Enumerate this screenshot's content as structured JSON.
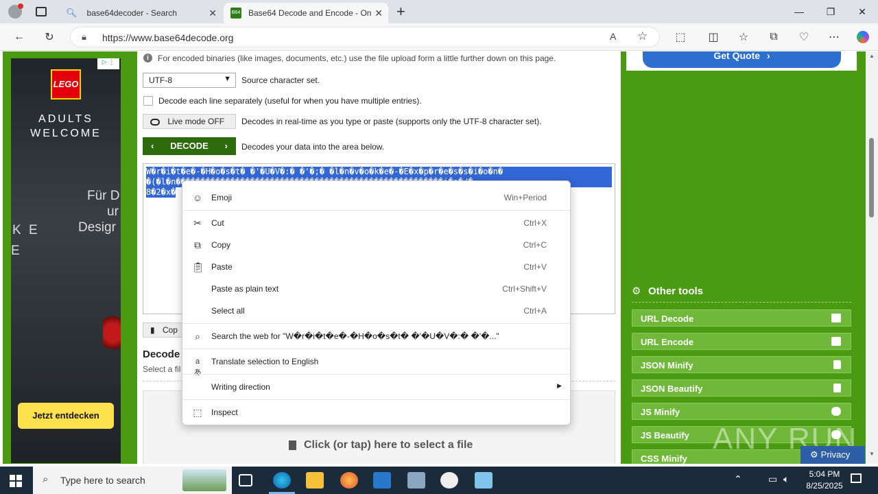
{
  "browser": {
    "tabs": [
      {
        "title": "base64decoder - Search"
      },
      {
        "title": "Base64 Decode and Encode - Onl"
      }
    ],
    "url": "https://www.base64decode.org",
    "new_tab_label": "+"
  },
  "ad_left": {
    "brand": "LEGO",
    "tagline_1": "ADULTS",
    "tagline_2": "WELCOME",
    "fragment_1": "Für D",
    "fragment_2": "ur",
    "fragment_3": "Desigr",
    "fragment_4": "K E",
    "fragment_5": "E",
    "cta": "Jetzt entdecken"
  },
  "content": {
    "info_text": "For encoded binaries (like images, documents, etc.) use the file upload form a little further down on this page.",
    "charset_value": "UTF-8",
    "charset_label": "Source character set.",
    "decode_lines_label": "Decode each line separately (useful for when you have multiple entries).",
    "live_mode_label": "Live mode OFF",
    "live_mode_desc": "Decodes in real-time as you type or paste (supports only the UTF-8 character set).",
    "decode_button": "DECODE",
    "decode_desc": "Decodes your data into the area below.",
    "output_line_1": "W�r�i�t�e�-�H�o�s�t� �'�U�V�:� �'�;� �l�n�v�o�k�e�-�E�x�p�r�e�s�s�i�o�n�",
    "output_line_2": "�(�l�n������������������������������������������������������i�o�/�",
    "output_line_3": "8�2�x�",
    "copy_label": "Cop",
    "decode_files_heading": "Decode",
    "select_file_label": "Select a fil",
    "upload_label": "Click (or tap) here to select a file"
  },
  "right": {
    "get_quote": "Get Quote",
    "other_tools_heading": "Other tools",
    "tools": [
      "URL Decode",
      "URL Encode",
      "JSON Minify",
      "JSON Beautify",
      "JS Minify",
      "JS Beautify",
      "CSS Minify"
    ],
    "watermark": "ANY RUN",
    "privacy": "Privacy"
  },
  "context_menu": {
    "items": [
      {
        "label": "Emoji",
        "shortcut": "Win+Period"
      },
      {
        "label": "Cut",
        "shortcut": "Ctrl+X"
      },
      {
        "label": "Copy",
        "shortcut": "Ctrl+C"
      },
      {
        "label": "Paste",
        "shortcut": "Ctrl+V"
      },
      {
        "label": "Paste as plain text",
        "shortcut": "Ctrl+Shift+V"
      },
      {
        "label": "Select all",
        "shortcut": "Ctrl+A"
      },
      {
        "label": "Search the web for \"W�r�i�t�e�-�H�o�s�t� �'�U�V�:� �'�...\"",
        "shortcut": ""
      },
      {
        "label": "Translate selection to English",
        "shortcut": ""
      },
      {
        "label": "Writing direction",
        "shortcut": ""
      },
      {
        "label": "Inspect",
        "shortcut": ""
      }
    ]
  },
  "taskbar": {
    "search_placeholder": "Type here to search",
    "time": "5:04 PM",
    "date": "8/25/2025"
  },
  "colors": {
    "site_green": "#4a9b11",
    "tool_green": "#6fb83a",
    "decode_btn": "#2e6b0d",
    "selection_blue": "#3367d6",
    "get_quote_blue": "#2c6fcf"
  }
}
